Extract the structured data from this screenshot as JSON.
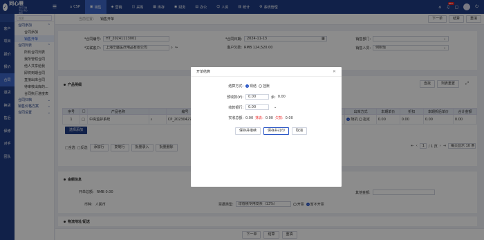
{
  "app": {
    "name": "同心雁",
    "subtitle": "我们只做专业·用心服务"
  },
  "top_nav": [
    {
      "label": "CSP",
      "icon": "home-icon"
    },
    {
      "label": "销售",
      "icon": "cart-icon",
      "active": true
    },
    {
      "label": "营销",
      "icon": "megaphone-icon"
    },
    {
      "label": "采购",
      "icon": "bag-icon"
    },
    {
      "label": "库存",
      "icon": "box-icon"
    },
    {
      "label": "财务",
      "icon": "coin-icon"
    },
    {
      "label": "办公",
      "icon": "briefcase-icon"
    },
    {
      "label": "人资",
      "icon": "user-icon"
    },
    {
      "label": "统计",
      "icon": "chart-icon"
    },
    {
      "label": "系统管理",
      "icon": "gear-icon"
    }
  ],
  "top_right": {
    "badge": "99+"
  },
  "sidebar": {
    "search_placeholder": "搜索",
    "items": [
      "客户",
      "项目",
      "报价",
      "报价",
      "合同",
      "退货",
      "换货",
      "售后",
      "保修",
      "对手",
      "团队"
    ],
    "active_index": 4
  },
  "submenu": {
    "groups": [
      {
        "label": "合同添加",
        "items": [
          "合同添加",
          "销售开单"
        ]
      },
      {
        "label": "合同列表",
        "items": [
          "所有合同列表",
          "我所管辖合同",
          "他人共享给我",
          "即将到期合同",
          "直接出库合同",
          "待审核出库的...",
          "合同执行进度表"
        ]
      },
      {
        "label": "合同归档",
        "items": []
      },
      {
        "label": "销售价格方案",
        "items": []
      },
      {
        "label": "合同设置",
        "items": []
      }
    ],
    "active_item": "销售开单"
  },
  "page": {
    "crumb_prefix": "当前位置：",
    "crumb_current": "销售开单",
    "top_buttons": [
      "下一单",
      "结算",
      "重填"
    ]
  },
  "form": {
    "contract_no_label": "*合同编号:",
    "contract_no": "HT_20241113001",
    "contract_date_label": "*合同日期:",
    "contract_date": "2024-11-13",
    "dept_label": "销售部门:",
    "customer_label": "*关联客户:",
    "customer": "上海华盛医疗用品有限公司",
    "balance_label": "客户欠款:",
    "balance": "RMB 124,520.00",
    "sales_label": "销售人员:",
    "sales": "何帆怡"
  },
  "products": {
    "section_title": "产品明细",
    "buttons": [
      "查找",
      "列表重置"
    ],
    "headers": [
      "序号",
      "",
      "产品名称",
      "",
      "编号",
      "型号",
      "",
      "",
      "",
      "",
      "",
      "出库方式",
      "本期单价",
      "折扣",
      "本期折后单价",
      "合计金额"
    ],
    "rows": [
      {
        "index": "1",
        "name": "中央监护系统",
        "code": "CP_2023042705",
        "model": "237",
        "outbound_a": "随机",
        "outbound_b": "指定",
        "price": "0.00",
        "discount": "0.00",
        "net_price": "0.00",
        "total": "0.00"
      }
    ],
    "add_button": "选择添加",
    "footer_checks": [
      "全选",
      "反选"
    ],
    "footer_buttons": [
      "添加行",
      "复制行",
      "批量录入",
      "批量删除"
    ],
    "pager": {
      "current": "1",
      "total_label": "/ 1 页",
      "per_page": "每页显示 10 条"
    }
  },
  "finance": {
    "section_title": "金额信息",
    "total_label": "开单总额:",
    "total": "RMB 0.00",
    "other_label": "其他金额:",
    "currency_label": "币种:",
    "currency": "人民币",
    "invoice_type_label": "票据类型:",
    "invoice_type": "增值税专用发票（13%）",
    "invoice_open": "开票",
    "invoice_none": "暂不开票"
  },
  "shipping": {
    "section_title": "物流地址/配送"
  },
  "bottom_buttons": [
    "下一单",
    "结算",
    "重填"
  ],
  "modal": {
    "title": "开单结算",
    "method_label": "结算方式:",
    "method_opt1": "现结",
    "method_opt2": "挂账",
    "prepaid_label": "预收款(¥):",
    "prepaid_value": "0.00",
    "prepaid_remain_label": "余:",
    "prepaid_remain": "0.00",
    "bank_label": "收款银行:",
    "bank_value": "0.00",
    "summary_label": "实收总额:",
    "summary_total": "0.00",
    "discount_label": "抹去:",
    "discount_value": "0.00",
    "due_label": "欠款:",
    "due_value": "0.00",
    "buttons": [
      "保存并继续",
      "保存并打印",
      "取消"
    ]
  },
  "colors": {
    "primary": "#1f3c86",
    "accent": "#2a56c6",
    "danger": "#e33333"
  }
}
